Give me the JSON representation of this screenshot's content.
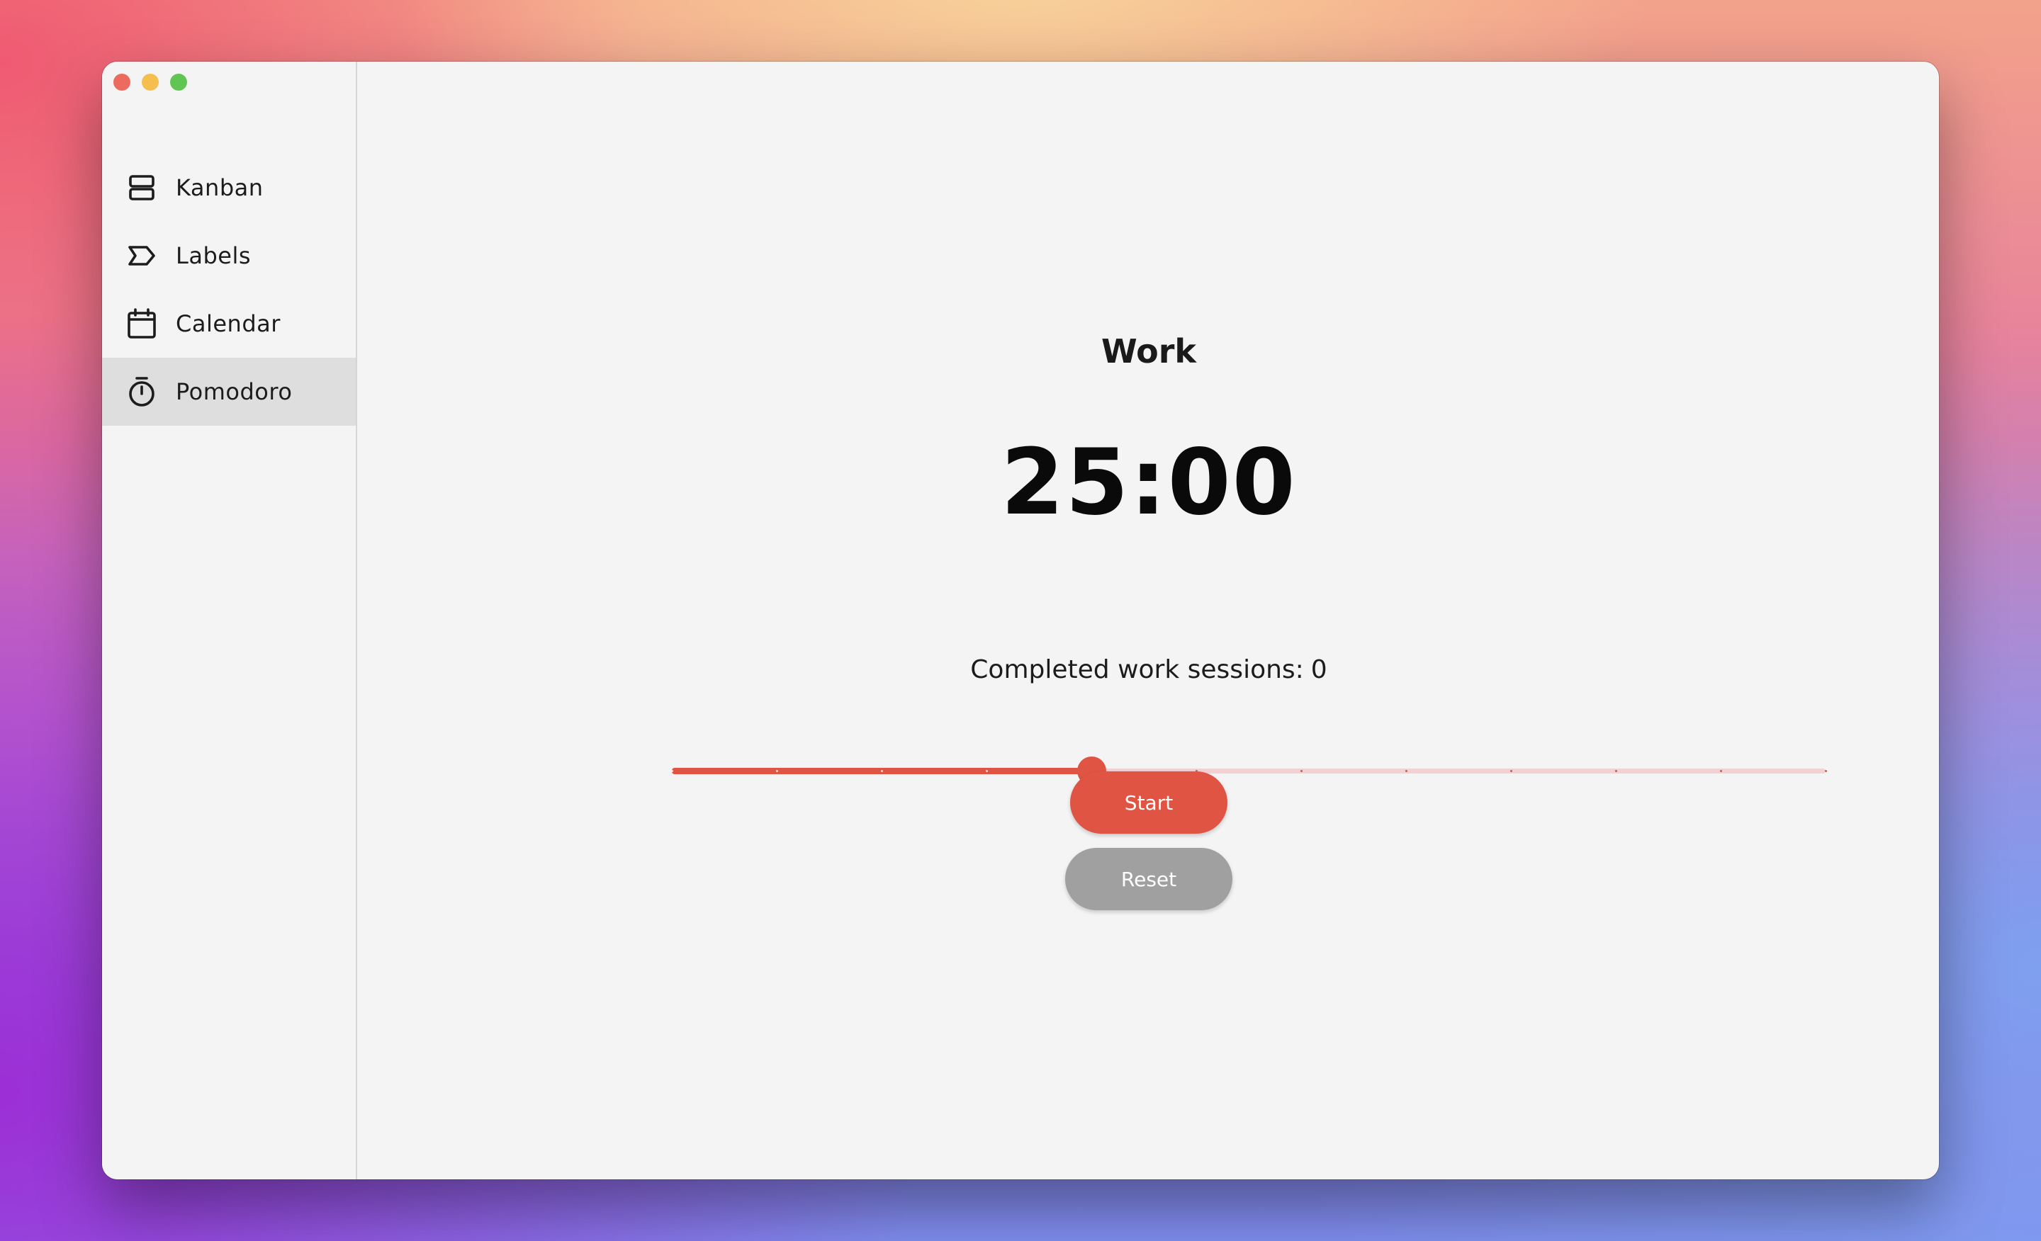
{
  "window": {
    "controls": [
      "close",
      "minimize",
      "zoom"
    ]
  },
  "sidebar": {
    "items": [
      {
        "label": "Kanban",
        "icon": "kanban-icon",
        "active": false
      },
      {
        "label": "Labels",
        "icon": "label-icon",
        "active": false
      },
      {
        "label": "Calendar",
        "icon": "calendar-icon",
        "active": false
      },
      {
        "label": "Pomodoro",
        "icon": "stopwatch-icon",
        "active": true
      }
    ]
  },
  "main": {
    "mode_title": "Work",
    "timer": "25:00",
    "sessions_label": "Completed work sessions:",
    "sessions_count": "0",
    "slider": {
      "min": 0,
      "max": 11,
      "value": 4,
      "fill_color": "#e05443",
      "track_color": "#f6cfd2"
    },
    "start_label": "Start",
    "reset_label": "Reset"
  },
  "colors": {
    "accent": "#e05443",
    "reset_button": "#a0a0a0",
    "active_nav": "#dedede"
  }
}
